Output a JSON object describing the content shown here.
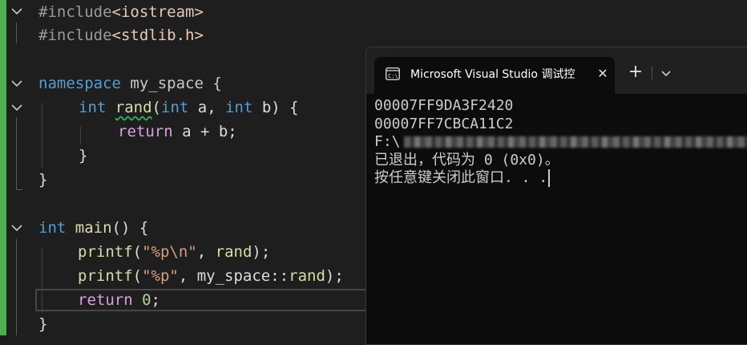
{
  "editor": {
    "lines": {
      "l1": {
        "pp": "#include",
        "inc": "<iostream>"
      },
      "l2": {
        "pp": "#include",
        "inc": "<stdlib.h>"
      },
      "l4": {
        "kw": "namespace",
        "name": " my_space {"
      },
      "l5": {
        "kw1": "int",
        "fn": "rand",
        "p1": "(",
        "kw2": "int",
        "a": " a, ",
        "kw3": "int",
        "b": " b) {"
      },
      "l6": {
        "ctl": "return",
        "rest": " a + b;"
      },
      "l7": {
        "text": "}"
      },
      "l8": {
        "text": "}"
      },
      "l10": {
        "kw": "int",
        "fn": "main",
        "rest": "() {"
      },
      "l11": {
        "fn": "printf",
        "p": "(",
        "str": "\"%p\\n\"",
        "mid": ", ",
        "fn2": "rand",
        "end": ");"
      },
      "l12": {
        "fn": "printf",
        "p": "(",
        "str": "\"%p\"",
        "mid": ", my_space::",
        "fn2": "rand",
        "end": ");"
      },
      "l13": {
        "ctl": "return",
        "num": "0",
        "end": ";"
      },
      "l14": {
        "text": "}"
      }
    }
  },
  "terminal": {
    "tab_title": "Microsoft Visual Studio 调试控",
    "close_glyph": "✕",
    "new_tab_glyph": "+",
    "output": {
      "line1": "00007FF9DA3F2420",
      "line2": "00007FF7CBCA11C2",
      "line3_prefix": "F:\\",
      "line4": "已退出，代码为 0 (0x0)。",
      "line5": "按任意键关闭此窗口. . ."
    }
  },
  "colors": {
    "editor_bg": "#1e1e1e",
    "keyword": "#569cd6",
    "control": "#d8a0df",
    "function": "#dcdcaa",
    "string": "#d69d85",
    "number": "#b5cea8",
    "change_bar": "#4caf50",
    "terminal_bg": "#0c0c0c"
  }
}
